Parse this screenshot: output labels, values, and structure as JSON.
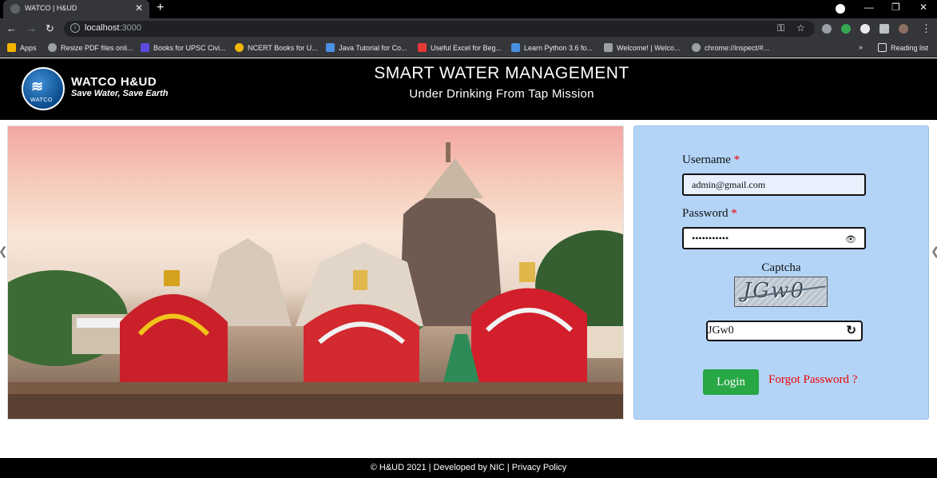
{
  "browser": {
    "tab_title": "WATCO | H&UD",
    "new_tab": "+",
    "url_host": "localhost",
    "url_port": ":3000",
    "bookmarks": [
      {
        "label": "Apps",
        "color": "#f4b400"
      },
      {
        "label": "Resize PDF files onli...",
        "color": "#9aa0a6"
      },
      {
        "label": "Books for UPSC Civi...",
        "color": "#5b4ce0"
      },
      {
        "label": "NCERT Books for U...",
        "color": "#f2b705"
      },
      {
        "label": "Java Tutorial for Co...",
        "color": "#4a90e2"
      },
      {
        "label": "Useful Excel for Beg...",
        "color": "#e53935"
      },
      {
        "label": "Learn Python 3.6 fo...",
        "color": "#4a90e2"
      },
      {
        "label": "Welcome! | Welco...",
        "color": "#9aa0a6"
      },
      {
        "label": "chrome://inspect/#...",
        "color": "#9aa0a6"
      }
    ],
    "more_bookmarks": "»",
    "reading_list": "Reading list"
  },
  "header": {
    "brand": "WATCO H&UD",
    "logo_text": "WATCO",
    "tagline": "Save Water, Save Earth",
    "title": "SMART WATER MANAGEMENT",
    "subtitle": "Under Drinking From Tap Mission"
  },
  "login": {
    "username_label": "Username",
    "username_value": "admin@gmail.com",
    "password_label": "Password",
    "password_value": "•••••••••••",
    "required_mark": "*",
    "captcha_label": "Captcha",
    "captcha_image_text": "JGw0",
    "captcha_value": "JGw0",
    "login_button": "Login",
    "forgot_link": "Forgot Password ?"
  },
  "footer": {
    "text": "© H&UD 2021 | Developed by NIC | Privacy Policy"
  },
  "colors": {
    "panel_bg": "#b3d4f7",
    "login_green": "#28a745",
    "required_red": "#e00000"
  }
}
